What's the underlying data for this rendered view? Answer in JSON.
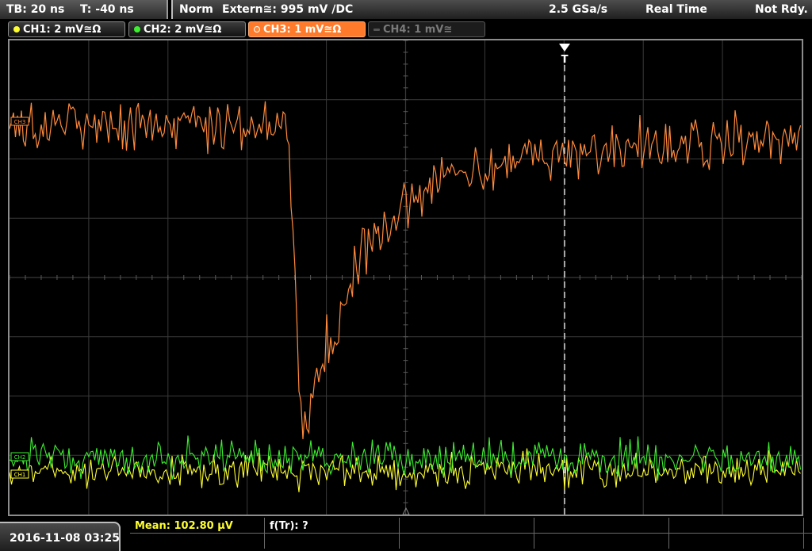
{
  "timebase": {
    "tb_label": "TB: 20 ns",
    "trigger_offset_label": "T: -40 ns"
  },
  "status": {
    "mode": "Norm",
    "trigger": "Extern≅: 995 mV ∕DC",
    "sample_rate": "2.5 GSa/s",
    "acq_mode": "Real Time",
    "ready_state": "Not Rdy."
  },
  "channels": [
    {
      "label": "CH1: 2 mV≅Ω",
      "color": "#ffff30",
      "state": "on"
    },
    {
      "label": "CH2: 2 mV≅Ω",
      "color": "#3cf030",
      "state": "on"
    },
    {
      "label": "CH3: 1 mV≅Ω",
      "color": "#ff8a3c",
      "state": "active"
    },
    {
      "label": "CH4: 1 mV≅",
      "color": "#777777",
      "state": "off"
    }
  ],
  "markers": {
    "ch1_ref": "CH1",
    "ch2_ref": "CH2",
    "ch3_ref": "CH3",
    "trigger_marker": "T"
  },
  "measurements": {
    "mean_label": "Mean: 102.80 µV",
    "ftr_label": "f(Tr): ?"
  },
  "datetime": "2016-11-08 03:25",
  "colors": {
    "ch1": "#ffff30",
    "ch2": "#3cf030",
    "ch3": "#ff8a3c",
    "grid": "#3a3a3a",
    "trigger_line": "#ffffff"
  }
}
